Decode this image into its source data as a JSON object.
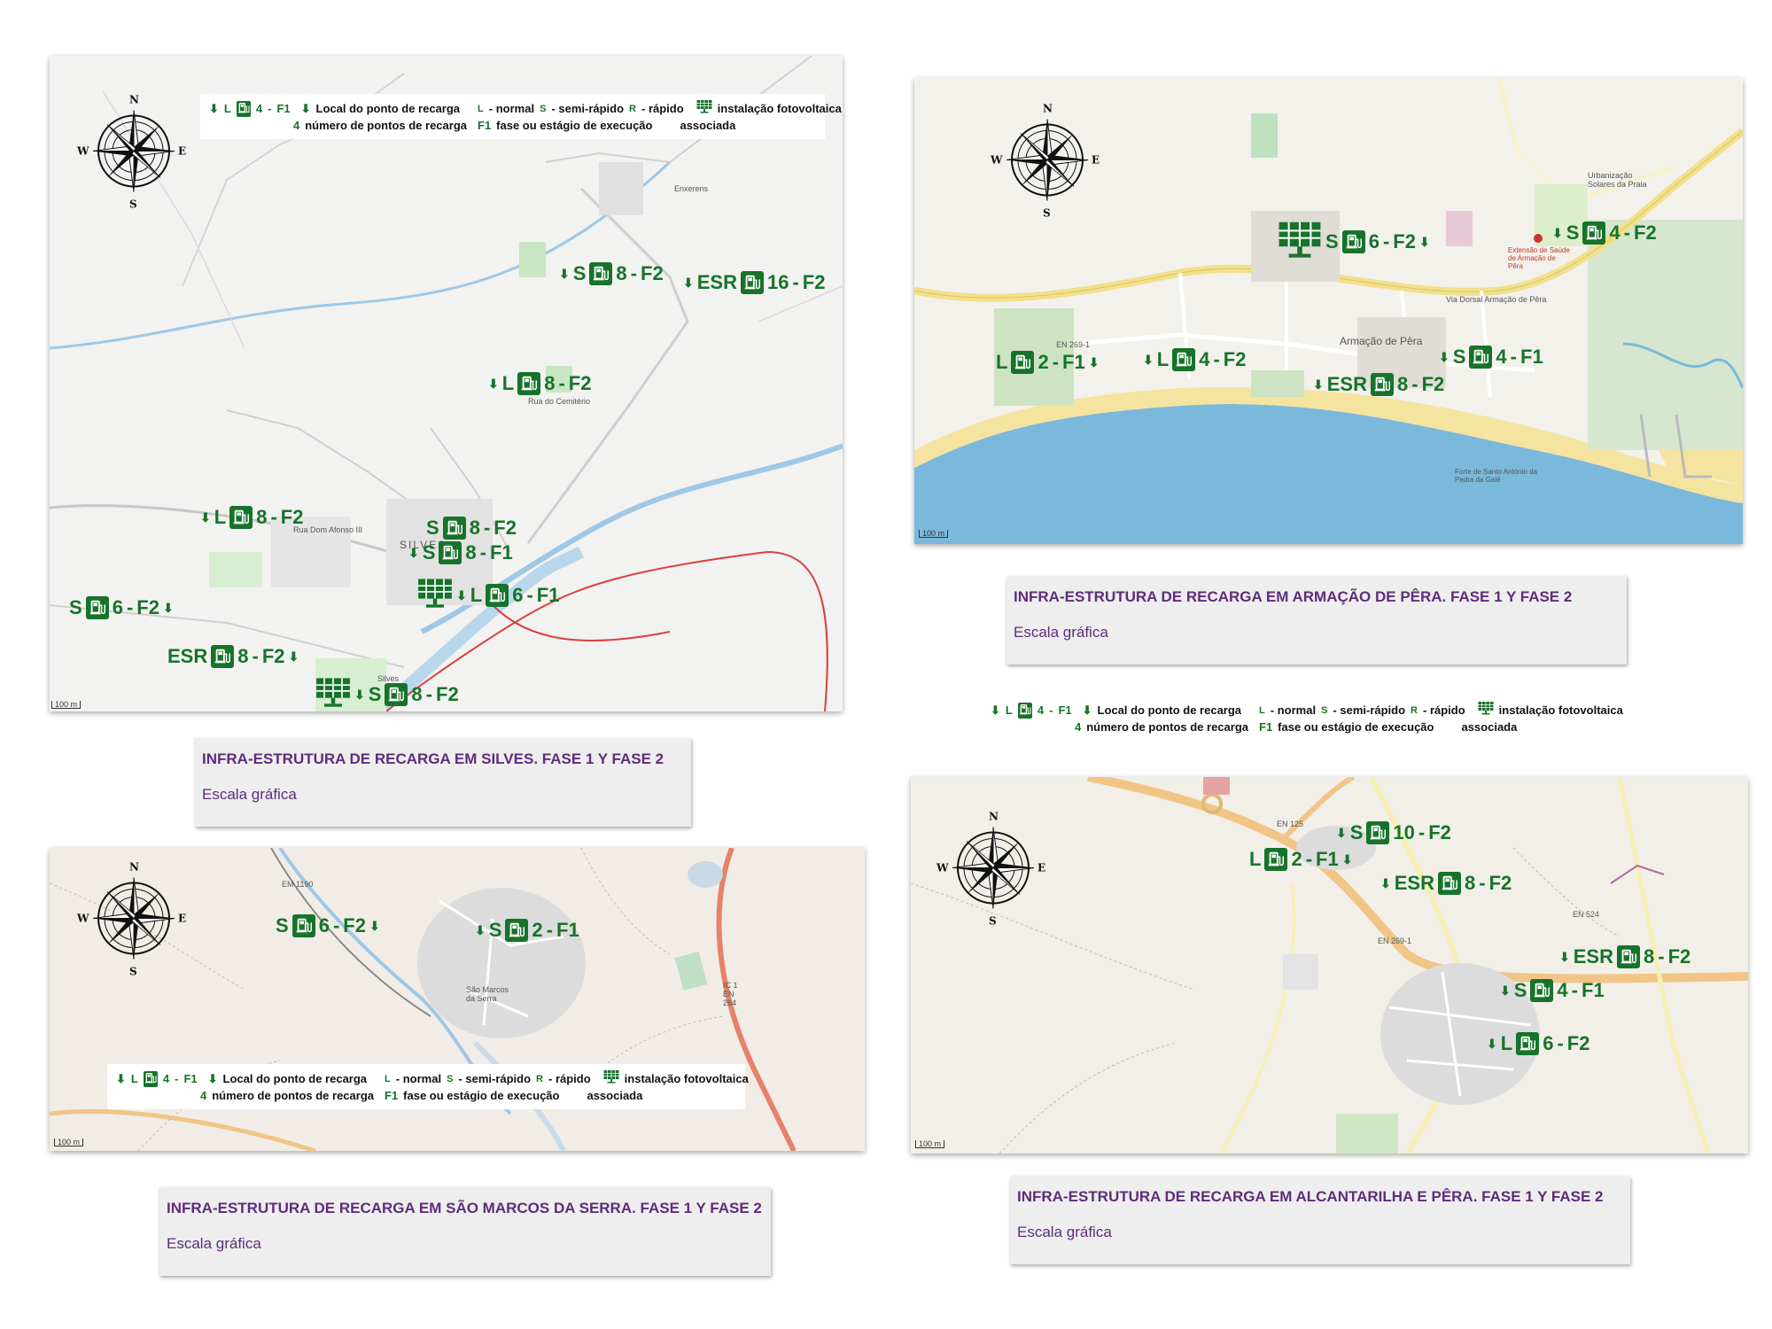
{
  "colors": {
    "marker_green": "#17732a",
    "caption_text": "#5e2d7a",
    "map_bg": "#f3f1ec",
    "sea": "#6fb3d6",
    "beach": "#f6e5a1"
  },
  "compass": {
    "n": "N",
    "s": "S",
    "e": "E",
    "w": "W"
  },
  "legend": {
    "marker_sample": {
      "letter": "L",
      "count": "4",
      "phase": "F1"
    },
    "line1_text": "Local do ponto de recarga",
    "type_L": "L",
    "type_L_text": "- normal",
    "type_S": "S",
    "type_S_text": "- semi-rápido",
    "type_R": "R",
    "type_R_text": "- rápido",
    "pv_text": "instalação fotovoltaica",
    "pv_text2": "associada",
    "count_digit": "4",
    "count_text": "número de pontos de recarga",
    "phase_code": "F1",
    "phase_text": "fase ou estágio de execução"
  },
  "scale_label": "100 m",
  "maps": {
    "silves": {
      "caption": {
        "title": "INFRA-ESTRUTURA DE RECARGA EM SILVES. FASE 1 Y FASE 2",
        "subtitle": "Escala gráfica"
      },
      "labels": [
        "SILVES",
        "Enxerens",
        "Rua do Cemitério",
        "Rua Dom Afonso III",
        "Silves"
      ],
      "markers": [
        {
          "letter": "S",
          "count": "8",
          "phase": "F2"
        },
        {
          "letter": "ESR",
          "count": "16",
          "phase": "F2"
        },
        {
          "letter": "L",
          "count": "8",
          "phase": "F2"
        },
        {
          "letter": "L",
          "count": "8",
          "phase": "F2"
        },
        {
          "letter": "S",
          "count": "8",
          "phase": "F2"
        },
        {
          "letter": "S",
          "count": "8",
          "phase": "F1"
        },
        {
          "letter": "L",
          "count": "6",
          "phase": "F1"
        },
        {
          "letter": "S",
          "count": "6",
          "phase": "F2"
        },
        {
          "letter": "ESR",
          "count": "8",
          "phase": "F2"
        },
        {
          "letter": "S",
          "count": "8",
          "phase": "F2"
        }
      ]
    },
    "armacao": {
      "caption": {
        "title": "INFRA-ESTRUTURA DE RECARGA EM ARMAÇÃO DE PÊRA. FASE 1 Y FASE 2",
        "subtitle": "Escala gráfica"
      },
      "labels": [
        "Armação de Pêra",
        "Via Dorsal Armação de Pêra",
        "EN 269-1",
        "Urbanização Solares da Praia",
        "Extensão de Saúde de Armação de Pêra",
        "Forte de Santo António da Pedra da Galé"
      ],
      "markers": [
        {
          "letter": "S",
          "count": "6",
          "phase": "F2"
        },
        {
          "letter": "S",
          "count": "4",
          "phase": "F2"
        },
        {
          "letter": "L",
          "count": "2",
          "phase": "F1"
        },
        {
          "letter": "L",
          "count": "4",
          "phase": "F2"
        },
        {
          "letter": "ESR",
          "count": "8",
          "phase": "F2"
        },
        {
          "letter": "S",
          "count": "4",
          "phase": "F1"
        }
      ]
    },
    "saomarcos": {
      "caption": {
        "title": "INFRA-ESTRUTURA DE RECARGA EM SÃO MARCOS DA SERRA. FASE 1 Y FASE 2",
        "subtitle": "Escala gráfica"
      },
      "labels": [
        "São Marcos da Serra",
        "EM 1190",
        "IC 1 EN 264"
      ],
      "markers": [
        {
          "letter": "S",
          "count": "6",
          "phase": "F2"
        },
        {
          "letter": "S",
          "count": "2",
          "phase": "F1"
        }
      ]
    },
    "alcantarilha": {
      "caption": {
        "title": "INFRA-ESTRUTURA DE RECARGA EM ALCANTARILHA E PÊRA. FASE 1 Y FASE 2",
        "subtitle": "Escala gráfica"
      },
      "labels": [
        "EN 125",
        "EN 269-1",
        "EN 524"
      ],
      "markers": [
        {
          "letter": "S",
          "count": "10",
          "phase": "F2"
        },
        {
          "letter": "L",
          "count": "2",
          "phase": "F1"
        },
        {
          "letter": "ESR",
          "count": "8",
          "phase": "F2"
        },
        {
          "letter": "ESR",
          "count": "8",
          "phase": "F2"
        },
        {
          "letter": "S",
          "count": "4",
          "phase": "F1"
        },
        {
          "letter": "L",
          "count": "6",
          "phase": "F2"
        }
      ]
    }
  }
}
